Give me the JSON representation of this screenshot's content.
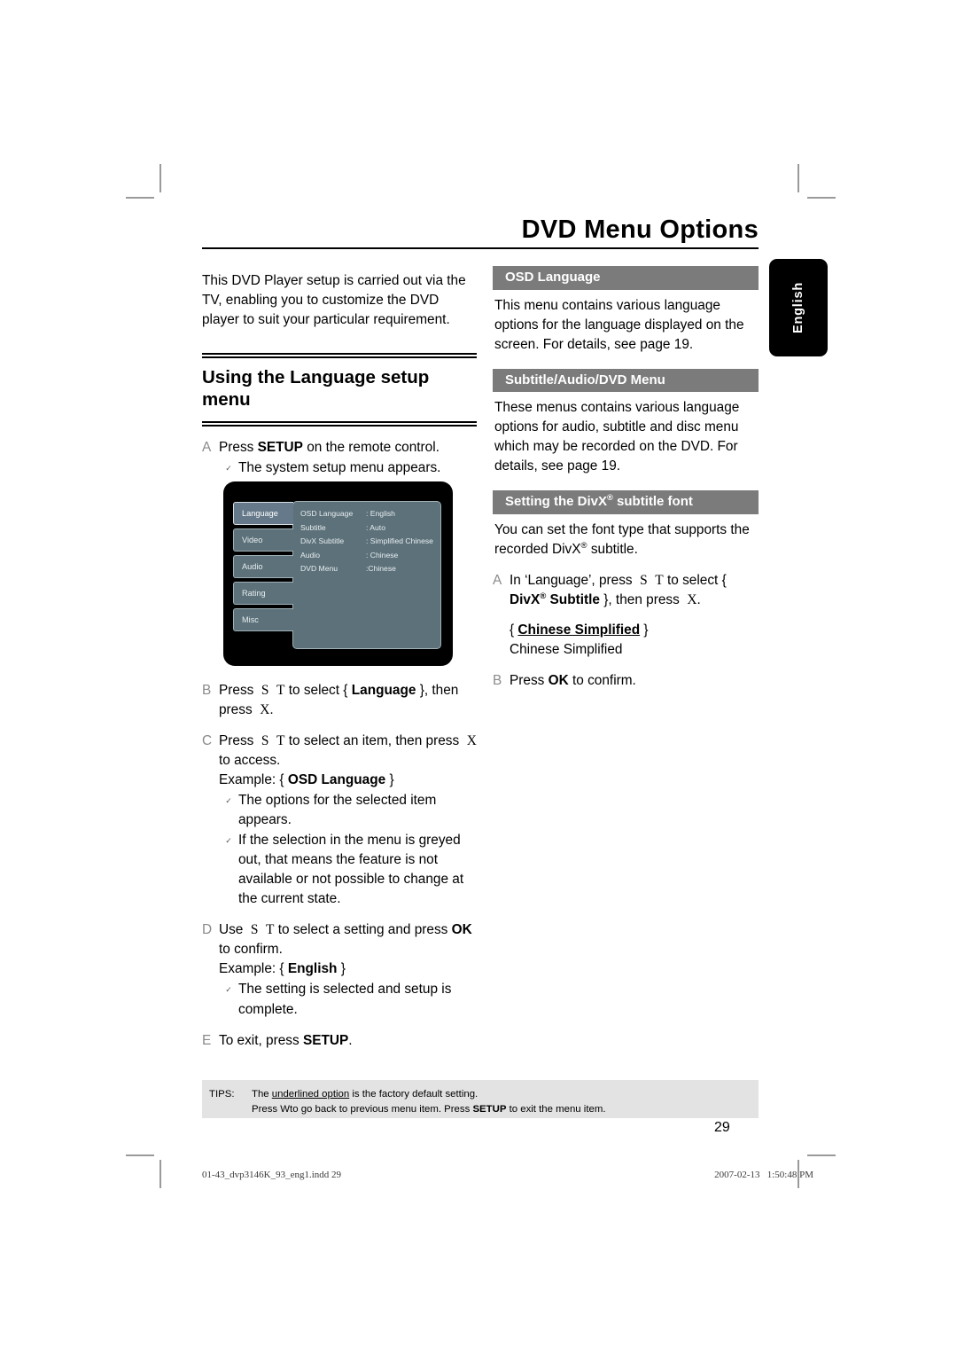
{
  "page": {
    "title": "DVD Menu Options",
    "number": "29",
    "side_tab": "English"
  },
  "left_column": {
    "intro": "This DVD Player setup is carried out via the TV, enabling you to customize the DVD player to suit your particular requirement.",
    "section_heading": "Using the Language setup menu",
    "steps": [
      {
        "letter": "A",
        "text_before": "Press ",
        "bold": "SETUP",
        "text_after": " on the remote control.",
        "sub": [
          "The system setup menu appears."
        ]
      },
      {
        "letter": "B",
        "line": "Press  S  T to select { Language }, then press  X.",
        "bold_token": "Language"
      },
      {
        "letter": "C",
        "line": "Press  S  T to select an item, then press  X to access.",
        "example_label": "Example: {",
        "example_value": "OSD Language",
        "example_close": "}",
        "sub": [
          "The options for the selected item appears.",
          "If the selection in the menu is greyed out, that means the feature is not available or not possible to change at the current state."
        ]
      },
      {
        "letter": "D",
        "line": "Use  S  T to select a setting and press OK to confirm.",
        "bold_token": "OK",
        "example_label": "Example: {",
        "example_value": "English",
        "example_close": "}",
        "sub": [
          "The setting is selected and setup is complete."
        ]
      },
      {
        "letter": "E",
        "text_before": "To exit, press ",
        "bold": "SETUP",
        "text_after": "."
      }
    ]
  },
  "osd_menu": {
    "tabs": [
      "Language",
      "Video",
      "Audio",
      "Rating",
      "Misc"
    ],
    "active_tab": "Language",
    "rows": [
      {
        "key": "OSD Language",
        "value": ": English"
      },
      {
        "key": "Subtitle",
        "value": ": Auto"
      },
      {
        "key": "DivX Subtitle",
        "value": ": Simplified Chinese"
      },
      {
        "key": "Audio",
        "value": ": Chinese"
      },
      {
        "key": "DVD Menu",
        "value": ":Chinese"
      }
    ]
  },
  "right_column": {
    "sections": [
      {
        "bar": "OSD Language",
        "body": "This menu contains various language options for the language displayed on the screen. For details, see page 19."
      },
      {
        "bar": "Subtitle/Audio/DVD Menu",
        "body": "These menus contains various language options for audio, subtitle and disc menu which may be recorded on the DVD. For details, see page 19."
      }
    ],
    "divx_section": {
      "bar_before": "Setting the DivX",
      "bar_reg": "®",
      "bar_after": " subtitle font",
      "body_before": "You can set the font type that supports the recorded DivX",
      "body_reg": "®",
      "body_after": " subtitle.",
      "steps": [
        {
          "letter": "A",
          "part1": "In ‘Language’, press  S  T to select { ",
          "bold1": "DivX",
          "reg": "®",
          "bold2": " Subtitle",
          "part2": " }, then press  X."
        },
        {
          "letter": "B",
          "text_before": "Press ",
          "bold": "OK",
          "text_after": " to confirm."
        }
      ],
      "option_open": "{ ",
      "option_default": "Chinese Simplified",
      "option_close": " }",
      "option_plain": "Chinese Simplified"
    }
  },
  "tips": {
    "label": "TIPS:",
    "line1_before": "The ",
    "line1_underlined": "underlined option",
    "line1_after": " is the factory default setting.",
    "line2_before": "Press  Wto go back to previous menu item. Press ",
    "line2_bold": "SETUP",
    "line2_after": " to exit the menu item."
  },
  "footer": {
    "file": "01-43_dvp3146K_93_eng1.indd   29",
    "date": "2007-02-13   1:50:48 PM"
  }
}
